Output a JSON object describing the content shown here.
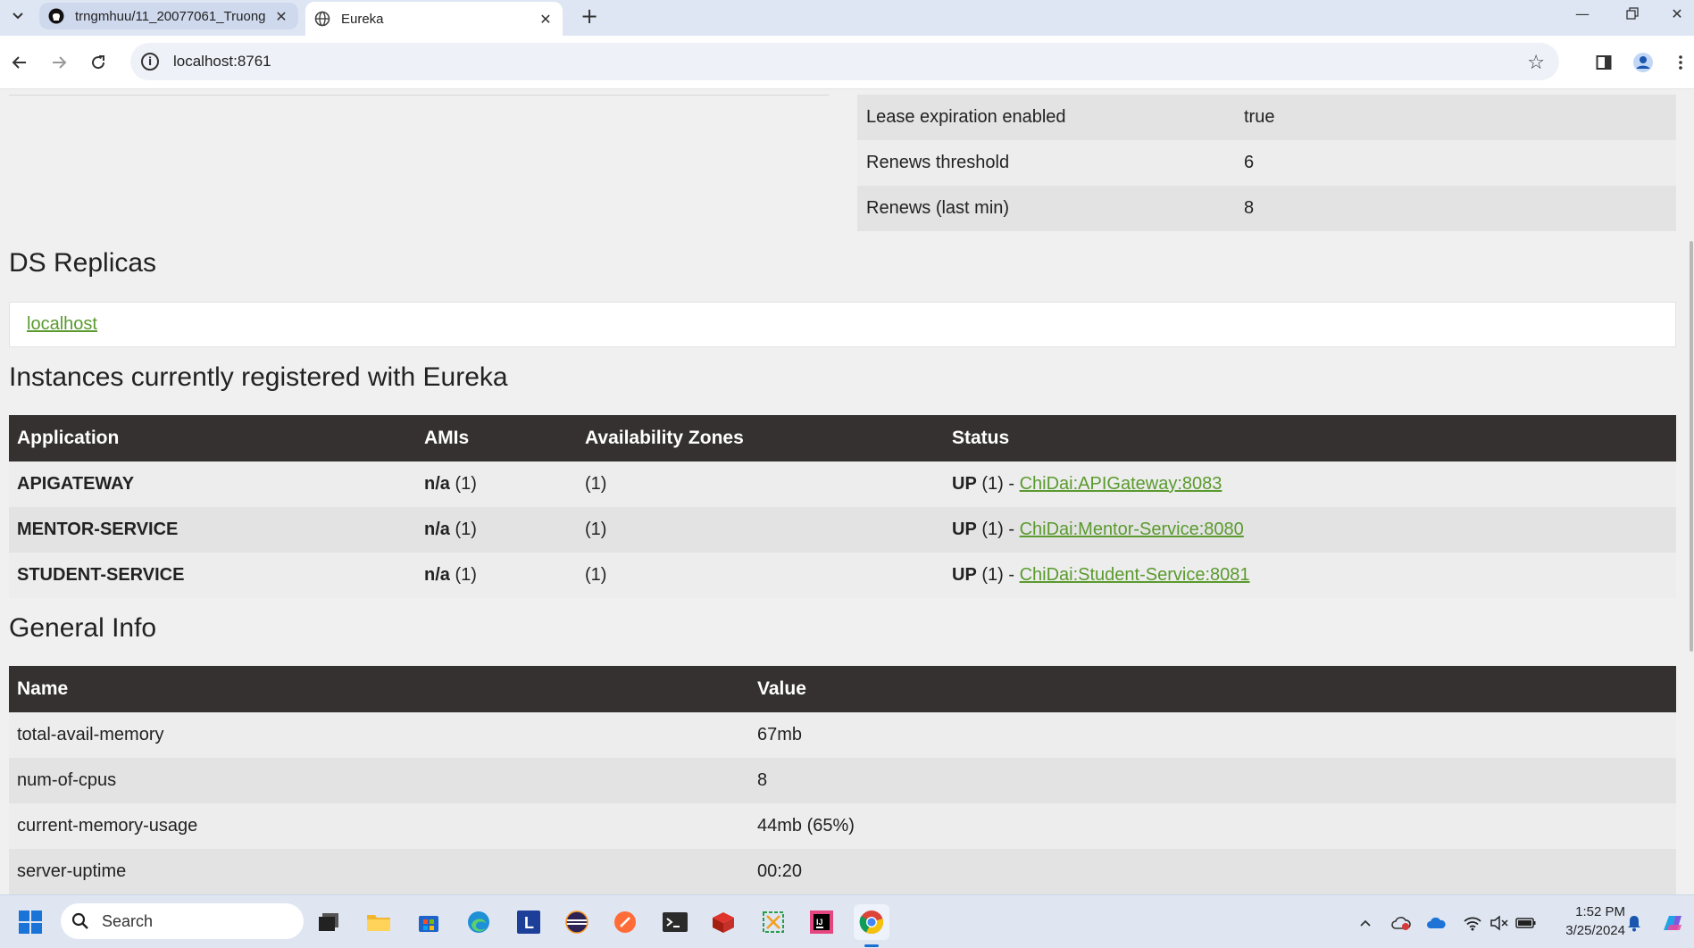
{
  "browser": {
    "tabs": [
      {
        "title": "trngmhuu/11_20077061_Truong",
        "favicon": "github-icon",
        "active": false
      },
      {
        "title": "Eureka",
        "favicon": "globe-icon",
        "active": true
      }
    ],
    "url": "localhost:8761"
  },
  "lease": {
    "rows": [
      {
        "key": "Lease expiration enabled",
        "value": "true"
      },
      {
        "key": "Renews threshold",
        "value": "6"
      },
      {
        "key": "Renews (last min)",
        "value": "8"
      }
    ]
  },
  "replicas": {
    "heading": "DS Replicas",
    "link": "localhost"
  },
  "instances": {
    "heading": "Instances currently registered with Eureka",
    "columns": [
      "Application",
      "AMIs",
      "Availability Zones",
      "Status"
    ],
    "rows": [
      {
        "application": "APIGATEWAY",
        "ami_bold": "n/a",
        "ami_count": " (1)",
        "zones": "(1)",
        "status_prefix_bold": "UP",
        "status_prefix": " (1) - ",
        "status_link": "ChiDai:APIGateway:8083"
      },
      {
        "application": "MENTOR-SERVICE",
        "ami_bold": "n/a",
        "ami_count": " (1)",
        "zones": "(1)",
        "status_prefix_bold": "UP",
        "status_prefix": " (1) - ",
        "status_link": "ChiDai:Mentor-Service:8080"
      },
      {
        "application": "STUDENT-SERVICE",
        "ami_bold": "n/a",
        "ami_count": " (1)",
        "zones": "(1)",
        "status_prefix_bold": "UP",
        "status_prefix": " (1) - ",
        "status_link": "ChiDai:Student-Service:8081"
      }
    ]
  },
  "general": {
    "heading": "General Info",
    "columns": [
      "Name",
      "Value"
    ],
    "rows": [
      {
        "name": "total-avail-memory",
        "value": "67mb"
      },
      {
        "name": "num-of-cpus",
        "value": "8"
      },
      {
        "name": "current-memory-usage",
        "value": "44mb (65%)"
      },
      {
        "name": "server-uptime",
        "value": "00:20"
      }
    ]
  },
  "taskbar": {
    "search_placeholder": "Search",
    "time": "1:52 PM",
    "date": "3/25/2024",
    "accent": "#1a6fd1"
  },
  "colors": {
    "link": "#5a9a2e",
    "table_header": "#363131",
    "page_bg": "#f0f0f0"
  }
}
